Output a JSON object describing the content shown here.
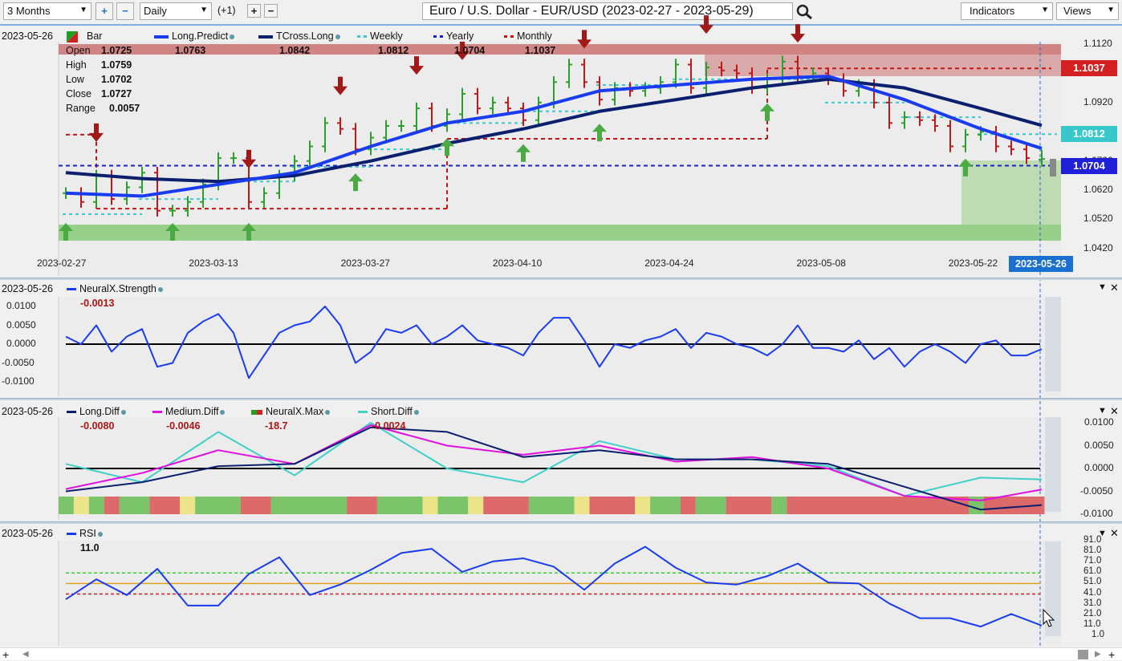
{
  "toolbar": {
    "period": "3 Months",
    "interval": "Daily",
    "offset": "(+1)",
    "title": "Euro / U.S. Dollar - EUR/USD (2023-02-27 - 2023-05-29)",
    "indicators": "Indicators",
    "views": "Views",
    "zoom_in": "+",
    "zoom_out": "−",
    "offset_plus": "+",
    "offset_minus": "−"
  },
  "price_panel": {
    "date": "2023-05-26",
    "bar_label": "Bar",
    "ohlc": [
      {
        "k": "Open",
        "v": "1.0725"
      },
      {
        "k": "High",
        "v": "1.0759"
      },
      {
        "k": "Low",
        "v": "1.0702"
      },
      {
        "k": "Close",
        "v": "1.0727"
      },
      {
        "k": "Range",
        "v": "0.0057"
      }
    ],
    "legend": [
      {
        "name": "Long.Predict",
        "value": "1.0763",
        "color": "#1a3cf0"
      },
      {
        "name": "TCross.Long",
        "value": "1.0842",
        "color": "#0a1f6e"
      },
      {
        "name": "Weekly",
        "value": "1.0812",
        "color": "#3cc8d0"
      },
      {
        "name": "Yearly",
        "value": "1.0704",
        "color": "#1a22c8"
      },
      {
        "name": "Monthly",
        "value": "1.1037",
        "color": "#c01818"
      }
    ],
    "y_ticks": [
      "1.1120",
      "1.1020",
      "1.0920",
      "1.0820",
      "1.0720",
      "1.0620",
      "1.0520",
      "1.0420"
    ],
    "x_ticks": [
      "2023-02-27",
      "2023-03-13",
      "2023-03-27",
      "2023-04-10",
      "2023-04-24",
      "2023-05-08",
      "2023-05-22"
    ],
    "cursor_date": "2023-05-26",
    "badges": [
      {
        "value": "1.1037",
        "color": "#d42020"
      },
      {
        "value": "1.0812",
        "color": "#38c8cc"
      },
      {
        "value": "1.0704",
        "color": "#2020d8"
      }
    ]
  },
  "chart_data": [
    {
      "type": "candlestick",
      "name": "EUR/USD daily",
      "ylim": [
        1.042,
        1.112
      ],
      "closes": [
        1.061,
        1.058,
        1.067,
        1.059,
        1.063,
        1.068,
        1.055,
        1.055,
        1.058,
        1.064,
        1.073,
        1.073,
        1.058,
        1.061,
        1.067,
        1.072,
        1.077,
        1.085,
        1.083,
        1.076,
        1.08,
        1.084,
        1.084,
        1.09,
        1.084,
        1.088,
        1.095,
        1.09,
        1.092,
        1.09,
        1.086,
        1.092,
        1.099,
        1.105,
        1.099,
        1.093,
        1.097,
        1.096,
        1.097,
        1.099,
        1.105,
        1.097,
        1.104,
        1.103,
        1.102,
        1.097,
        1.1,
        1.106,
        1.101,
        1.102,
        1.1,
        1.096,
        1.098,
        1.092,
        1.085,
        1.087,
        1.086,
        1.084,
        1.077,
        1.081,
        1.082,
        1.077,
        1.076,
        1.073,
        1.0727
      ],
      "last_bar": {
        "open": 1.0725,
        "high": 1.0759,
        "low": 1.0702,
        "close": 1.0727
      },
      "sell_signal_days": [
        2,
        12,
        18,
        23,
        26,
        34,
        42,
        48
      ],
      "buy_signal_days": [
        0,
        7,
        12,
        19,
        25,
        30,
        35,
        46,
        59
      ],
      "long_predict_weekly": [
        1.061,
        1.06,
        1.064,
        1.068,
        1.077,
        1.085,
        1.089,
        1.096,
        1.098,
        1.1,
        1.101,
        1.093,
        1.083,
        1.0763
      ],
      "tcross_long_weekly": [
        1.068,
        1.066,
        1.065,
        1.067,
        1.072,
        1.078,
        1.083,
        1.089,
        1.093,
        1.097,
        1.1,
        1.097,
        1.09,
        1.0842
      ],
      "weekly_levels": [
        1.0538,
        1.059,
        1.065,
        1.07,
        1.076,
        1.085,
        1.089,
        1.098,
        1.1,
        1.1,
        1.092,
        1.087,
        1.0812
      ],
      "monthly_levels": [
        {
          "from": 0,
          "to": 1,
          "value": 1.081
        },
        {
          "from": 2,
          "to": 24,
          "value": 1.0557
        },
        {
          "from": 25,
          "to": 45,
          "value": 1.0796
        },
        {
          "from": 46,
          "to": 64,
          "value": 1.1037
        }
      ],
      "yearly_level": 1.0704
    },
    {
      "type": "line",
      "name": "NeuralX.Strength",
      "ylim": [
        -0.01,
        0.01
      ],
      "values": [
        0.002,
        0.0,
        0.005,
        -0.002,
        0.002,
        0.004,
        -0.006,
        -0.005,
        0.003,
        0.006,
        0.008,
        0.003,
        -0.009,
        -0.003,
        0.003,
        0.005,
        0.006,
        0.01,
        0.005,
        -0.005,
        -0.002,
        0.004,
        0.003,
        0.005,
        0.0,
        0.002,
        0.005,
        0.001,
        0.0,
        -0.001,
        -0.003,
        0.003,
        0.007,
        0.007,
        0.001,
        -0.006,
        0.0,
        -0.001,
        0.001,
        0.002,
        0.004,
        -0.001,
        0.003,
        0.002,
        0.0,
        -0.001,
        -0.003,
        0.0,
        0.005,
        -0.001,
        -0.001,
        -0.002,
        0.001,
        -0.004,
        -0.001,
        -0.006,
        -0.002,
        0.0,
        -0.002,
        -0.005,
        0.0,
        0.001,
        -0.003,
        -0.003,
        -0.0013
      ]
    },
    {
      "type": "line",
      "name": "Diff",
      "ylim": [
        -0.01,
        0.01
      ],
      "series": [
        {
          "name": "Long.Diff",
          "color": "#0a1f6e",
          "values": [
            -0.005,
            -0.003,
            0.0005,
            0.001,
            0.009,
            0.008,
            0.0025,
            0.004,
            0.002,
            0.002,
            0.001,
            -0.004,
            -0.009,
            -0.008
          ]
        },
        {
          "name": "Medium.Diff",
          "color": "#e010e0",
          "values": [
            -0.0045,
            -0.001,
            0.004,
            0.001,
            0.0095,
            0.005,
            0.003,
            0.005,
            0.0015,
            0.0025,
            0.0,
            -0.006,
            -0.007,
            -0.0046
          ]
        },
        {
          "name": "Short.Diff",
          "color": "#40d0c8",
          "values": [
            0.001,
            -0.003,
            0.008,
            -0.0015,
            0.01,
            0.0,
            -0.003,
            0.006,
            0.002,
            0.002,
            0.0005,
            -0.006,
            -0.002,
            -0.0024
          ]
        }
      ],
      "neuralx_max": [
        [
          "g",
          1
        ],
        [
          "y",
          1
        ],
        [
          "g",
          1
        ],
        [
          "r",
          1
        ],
        [
          "g",
          2
        ],
        [
          "r",
          2
        ],
        [
          "y",
          1
        ],
        [
          "g",
          3
        ],
        [
          "r",
          2
        ],
        [
          "g",
          5
        ],
        [
          "r",
          2
        ],
        [
          "g",
          3
        ],
        [
          "y",
          1
        ],
        [
          "g",
          2
        ],
        [
          "y",
          1
        ],
        [
          "r",
          3
        ],
        [
          "g",
          3
        ],
        [
          "y",
          1
        ],
        [
          "r",
          3
        ],
        [
          "y",
          1
        ],
        [
          "g",
          2
        ],
        [
          "r",
          1
        ],
        [
          "g",
          2
        ],
        [
          "r",
          3
        ],
        [
          "g",
          1
        ],
        [
          "r",
          12
        ],
        [
          "g",
          1
        ],
        [
          "r",
          4
        ]
      ]
    },
    {
      "type": "line",
      "name": "RSI",
      "ylim": [
        1,
        91
      ],
      "levels": [
        61,
        51,
        41
      ],
      "values_every_2_days": [
        36,
        55,
        40,
        65,
        30,
        30,
        60,
        76,
        40,
        50,
        64,
        80,
        84,
        62,
        72,
        75,
        67,
        45,
        70,
        86,
        66,
        52,
        50,
        58,
        70,
        52,
        51,
        32,
        18,
        18,
        10,
        22,
        11
      ]
    }
  ],
  "strength_panel": {
    "date": "2023-05-26",
    "name": "NeuralX.Strength",
    "value": "-0.0013",
    "y_ticks": [
      "0.0100",
      "0.0050",
      "0.0000",
      "-0.0050",
      "-0.0100"
    ]
  },
  "diff_panel": {
    "date": "2023-05-26",
    "legend": [
      {
        "name": "Long.Diff",
        "value": "-0.0080"
      },
      {
        "name": "Medium.Diff",
        "value": "-0.0046"
      },
      {
        "name": "NeuralX.Max",
        "value": "-18.7"
      },
      {
        "name": "Short.Diff",
        "value": "-0.0024"
      }
    ],
    "y_ticks": [
      "0.0100",
      "0.0050",
      "0.0000",
      "-0.0050",
      "-0.0100"
    ]
  },
  "rsi_panel": {
    "date": "2023-05-26",
    "name": "RSI",
    "value": "11.0",
    "y_ticks": [
      "91.0",
      "81.0",
      "71.0",
      "61.0",
      "51.0",
      "41.0",
      "31.0",
      "21.0",
      "11.0",
      "1.0"
    ]
  },
  "panel_controls": {
    "collapse": "▼",
    "close": "✕"
  },
  "scrollbar": {
    "left": "◀",
    "right": "▶",
    "plus": "+"
  }
}
